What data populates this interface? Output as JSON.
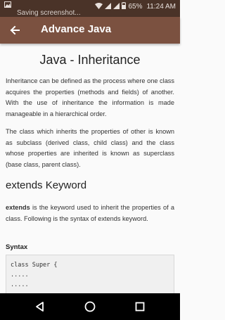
{
  "status_bar": {
    "battery": "65%",
    "time": "11:24 AM",
    "ticker": "Saving screenshot..."
  },
  "app_bar": {
    "title": "Advance Java"
  },
  "content": {
    "title": "Java - Inheritance",
    "para1": "Inheritance can be defined as the process where one class acquires the properties (methods and fields) of another. With the use of inheritance the information is made manageable in a hierarchical order.",
    "para2": "The class which inherits the properties of other is known as subclass (derived class, child class) and the class whose properties are inherited is known as superclass (base class, parent class).",
    "section_heading": "extends Keyword",
    "para3_bold": "extends",
    "para3_rest": " is the keyword used to inherit the properties of a class. Following is the syntax of extends keyword.",
    "syntax_label": "Syntax",
    "code_lines": [
      "class Super {",
      ".....",
      "....."
    ]
  },
  "icons": {
    "back": "arrow-back-icon",
    "nav_back": "triangle-back-icon",
    "nav_home": "circle-home-icon",
    "nav_recents": "square-recents-icon"
  },
  "colors": {
    "status_bar": "#4a3328",
    "app_bar": "#7b5140",
    "background": "#fafafa",
    "code_background": "#f0f0f0"
  }
}
